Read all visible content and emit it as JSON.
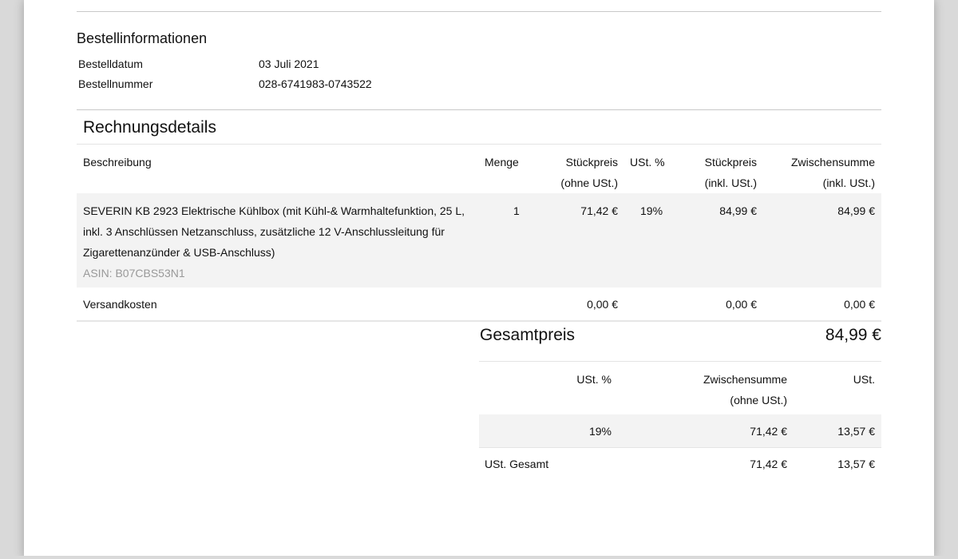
{
  "order_info": {
    "title": "Bestellinformationen",
    "date_label": "Bestelldatum",
    "date_value": "03 Juli 2021",
    "number_label": "Bestellnummer",
    "number_value": "028-6741983-0743522"
  },
  "invoice": {
    "title": "Rechnungsdetails",
    "headers": {
      "description": "Beschreibung",
      "quantity": "Menge",
      "unit_price_net_1": "Stückpreis",
      "unit_price_net_2": "(ohne USt.)",
      "vat_percent": "USt. %",
      "unit_price_gross_1": "Stückpreis",
      "unit_price_gross_2": "(inkl. USt.)",
      "subtotal_1": "Zwischensumme",
      "subtotal_2": "(inkl. USt.)"
    },
    "item": {
      "description": "SEVERIN KB 2923 Elektrische Kühlbox (mit Kühl-& Warmhaltefunktion, 25 L, inkl. 3 Anschlüssen Netzanschluss, zusätzliche 12 V-Anschlussleitung für Zigarettenanzünder & USB-Anschluss)",
      "asin": "ASIN: B07CBS53N1",
      "quantity": "1",
      "unit_price_net": "71,42 €",
      "vat_percent": "19%",
      "unit_price_gross": "84,99 €",
      "subtotal": "84,99 €"
    },
    "shipping": {
      "label": "Versandkosten",
      "unit_price_net": "0,00 €",
      "unit_price_gross": "0,00 €",
      "subtotal": "0,00 €"
    },
    "total": {
      "label": "Gesamtpreis",
      "value": "84,99 €"
    }
  },
  "vat_summary": {
    "headers": {
      "vat_percent": "USt. %",
      "subtotal_1": "Zwischensumme",
      "subtotal_2": "(ohne USt.)",
      "vat": "USt."
    },
    "row": {
      "vat_percent": "19%",
      "subtotal": "71,42 €",
      "vat": "13,57 €"
    },
    "total_row": {
      "label": "USt. Gesamt",
      "subtotal": "71,42 €",
      "vat": "13,57 €"
    }
  }
}
